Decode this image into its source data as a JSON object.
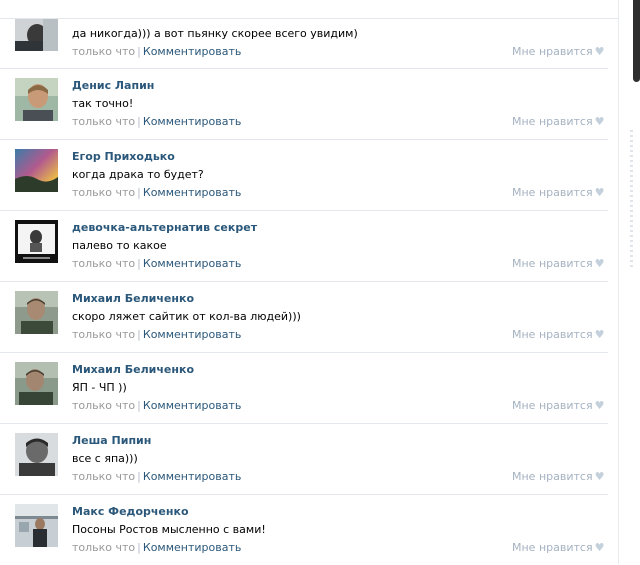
{
  "labels": {
    "time": "только что",
    "comment": "Комментировать",
    "like": "Мне нравится",
    "heart_icon": "heart-icon"
  },
  "comments": [
    {
      "name": "",
      "text": "да никогда))) а вот пьянку скорее всего увидим)"
    },
    {
      "name": "Денис Лапин",
      "text": "так точно!"
    },
    {
      "name": "Егор Приходько",
      "text": "когда драка то будет?"
    },
    {
      "name": "девочка-альтернатив секрет",
      "text": "палево то какое"
    },
    {
      "name": "Михаил Беличенко",
      "text": "скоро ляжет сайтик от кол-ва людей)))"
    },
    {
      "name": "Михаил Беличенко",
      "text": "ЯП - ЧП ))"
    },
    {
      "name": "Леша Пипин",
      "text": "все с япа)))"
    },
    {
      "name": "Макс Федорченко",
      "text": "Посоны Ростов мысленно с вами!"
    }
  ],
  "colors": {
    "link": "#2b587a",
    "muted": "#999999",
    "like": "#a5b2c1",
    "divider": "#e4e8ed"
  }
}
